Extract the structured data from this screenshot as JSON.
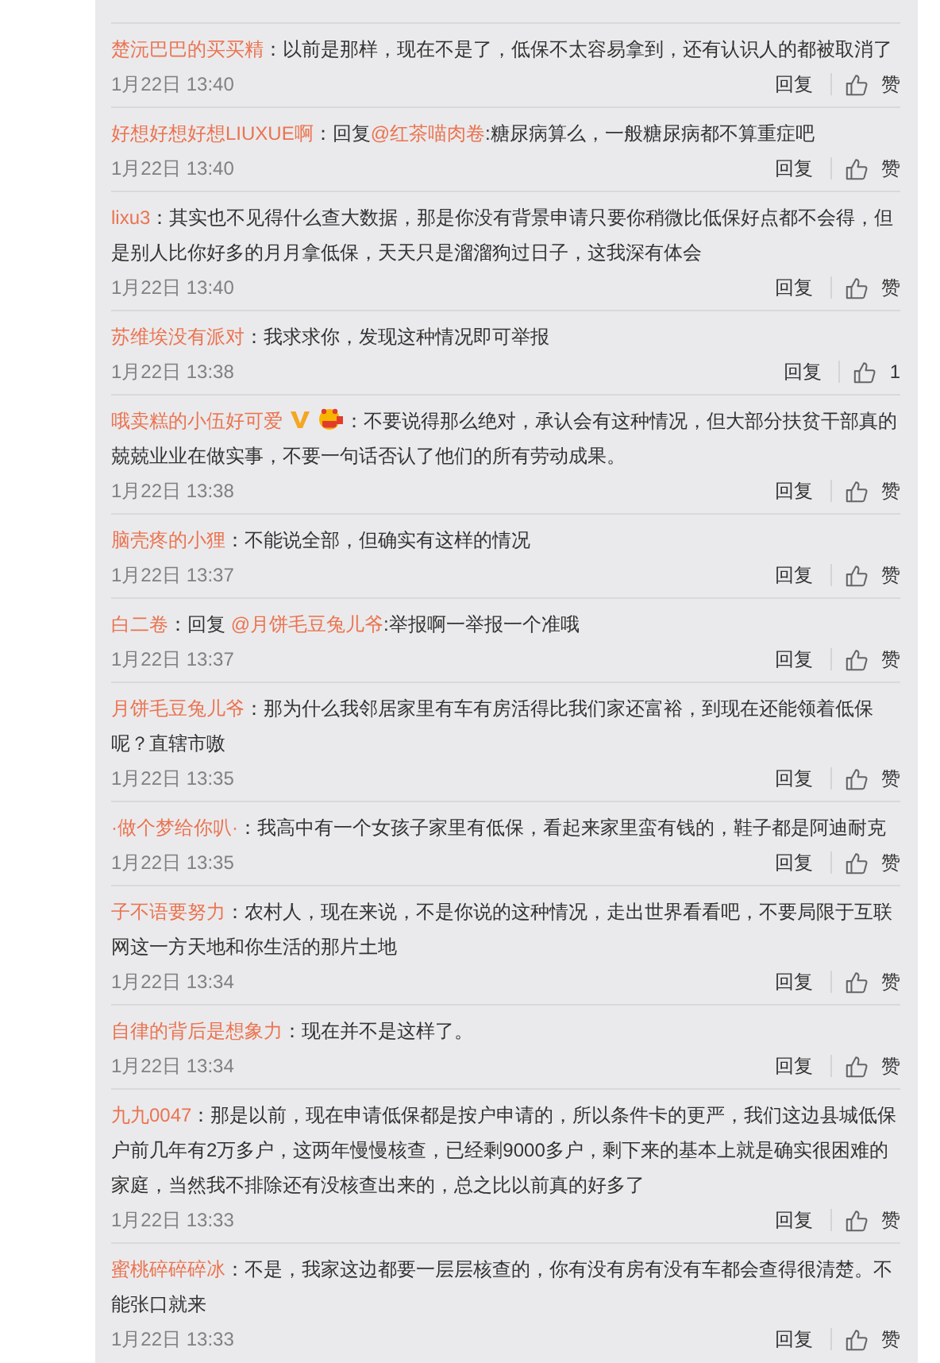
{
  "comments": [
    {
      "user": "楚沅巴巴的买买精",
      "segments": [
        {
          "kind": "plain",
          "text": "：以前是那样，现在不是了，低保不太容易拿到，还有认识人的都被取消了"
        }
      ],
      "time": "1月22日 13:40",
      "reply": "回复",
      "like": "赞"
    },
    {
      "user": "好想好想好想LIUXUE啊",
      "segments": [
        {
          "kind": "plain",
          "text": "：回复"
        },
        {
          "kind": "mention",
          "text": "@红茶喵肉卷"
        },
        {
          "kind": "plain",
          "text": ":糖尿病算么，一般糖尿病都不算重症吧"
        }
      ],
      "time": "1月22日 13:40",
      "reply": "回复",
      "like": "赞"
    },
    {
      "user": "lixu3",
      "segments": [
        {
          "kind": "plain",
          "text": "：其实也不见得什么查大数据，那是你没有背景申请只要你稍微比低保好点都不会得，但是别人比你好多的月月拿低保，天天只是溜溜狗过日子，这我深有体会"
        }
      ],
      "time": "1月22日 13:40",
      "reply": "回复",
      "like": "赞"
    },
    {
      "user": "苏维埃没有派对",
      "segments": [
        {
          "kind": "plain",
          "text": "：我求求你，发现这种情况即可举报"
        }
      ],
      "time": "1月22日 13:38",
      "reply": "回复",
      "like": "1"
    },
    {
      "user": "哦卖糕的小伍好可爱",
      "badges": [
        {
          "kind": "verified"
        },
        {
          "kind": "member"
        }
      ],
      "segments": [
        {
          "kind": "plain",
          "text": "：不要说得那么绝对，承认会有这种情况，但大部分扶贫干部真的兢兢业业在做实事，不要一句话否认了他们的所有劳动成果。"
        }
      ],
      "time": "1月22日 13:38",
      "reply": "回复",
      "like": "赞"
    },
    {
      "user": "脑壳疼的小狸",
      "segments": [
        {
          "kind": "plain",
          "text": "：不能说全部，但确实有这样的情况"
        }
      ],
      "time": "1月22日 13:37",
      "reply": "回复",
      "like": "赞"
    },
    {
      "user": "白二卷",
      "segments": [
        {
          "kind": "plain",
          "text": "：回复 "
        },
        {
          "kind": "mention",
          "text": "@月饼毛豆兔儿爷"
        },
        {
          "kind": "plain",
          "text": ":举报啊一举报一个准哦"
        }
      ],
      "time": "1月22日 13:37",
      "reply": "回复",
      "like": "赞"
    },
    {
      "user": "月饼毛豆兔儿爷",
      "segments": [
        {
          "kind": "plain",
          "text": "：那为什么我邻居家里有车有房活得比我们家还富裕，到现在还能领着低保呢？直辖市嗷"
        }
      ],
      "time": "1月22日 13:35",
      "reply": "回复",
      "like": "赞"
    },
    {
      "user": "·做个梦给你叭·",
      "segments": [
        {
          "kind": "plain",
          "text": "：我高中有一个女孩子家里有低保，看起来家里蛮有钱的，鞋子都是阿迪耐克"
        }
      ],
      "time": "1月22日 13:35",
      "reply": "回复",
      "like": "赞"
    },
    {
      "user": "子不语要努力",
      "segments": [
        {
          "kind": "plain",
          "text": "：农村人，现在来说，不是你说的这种情况，走出世界看看吧，不要局限于互联网这一方天地和你生活的那片土地"
        }
      ],
      "time": "1月22日 13:34",
      "reply": "回复",
      "like": "赞"
    },
    {
      "user": "自律的背后是想象力",
      "segments": [
        {
          "kind": "plain",
          "text": "：现在并不是这样了。"
        }
      ],
      "time": "1月22日 13:34",
      "reply": "回复",
      "like": "赞"
    },
    {
      "user": "九九0047",
      "segments": [
        {
          "kind": "plain",
          "text": "：那是以前，现在申请低保都是按户申请的，所以条件卡的更严，我们这边县城低保户前几年有2万多户，这两年慢慢核查，已经剩9000多户，剩下来的基本上就是确实很困难的家庭，当然我不排除还有没核查出来的，总之比以前真的好多了"
        }
      ],
      "time": "1月22日 13:33",
      "reply": "回复",
      "like": "赞"
    },
    {
      "user": "蜜桃碎碎碎冰",
      "segments": [
        {
          "kind": "plain",
          "text": "：不是，我家这边都要一层层核查的，你有没有房有没有车都会查得很清楚。不能张口就来"
        }
      ],
      "time": "1月22日 13:33",
      "reply": "回复",
      "like": "赞"
    }
  ]
}
